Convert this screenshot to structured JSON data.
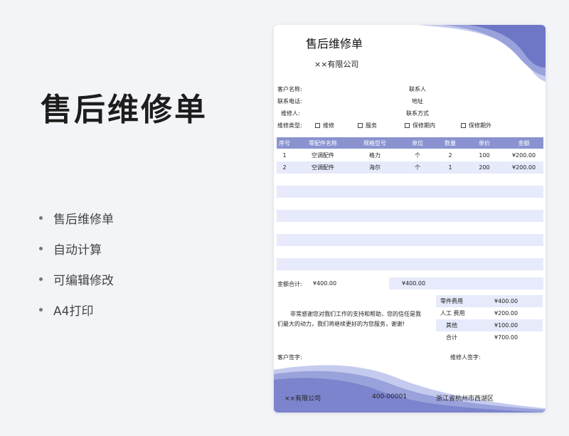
{
  "page": {
    "title": "售后维修单",
    "features": [
      "售后维修单",
      "自动计算",
      "可编辑修改",
      "A4打印"
    ]
  },
  "doc": {
    "title": "售后维修单",
    "company": "××有限公司",
    "fields": {
      "customer_name": "客户名称:",
      "contact": "联系人",
      "phone": "联系电话:",
      "address": "地址",
      "repairer": "维修人:",
      "contact_method": "联系方式",
      "repair_type": "维修类型:"
    },
    "repair_types": [
      "维修",
      "服务",
      "保修期内",
      "保修期外"
    ],
    "table": {
      "headers": [
        "序号",
        "零配件名称",
        "规格型号",
        "单位",
        "数量",
        "单价",
        "金额"
      ],
      "rows": [
        [
          "1",
          "空调配件",
          "格力",
          "个",
          "2",
          "100",
          "¥200.00"
        ],
        [
          "2",
          "空调配件",
          "海尔",
          "个",
          "1",
          "200",
          "¥200.00"
        ]
      ]
    },
    "total": {
      "label": "金额合计:",
      "value": "¥400.00",
      "value2": "¥400.00"
    },
    "costs": [
      {
        "label": "零件费用",
        "value": "¥400.00"
      },
      {
        "label": "人工 费用",
        "value": "¥200.00"
      },
      {
        "label": "其他",
        "value": "¥100.00"
      },
      {
        "label": "合计",
        "value": "¥700.00"
      }
    ],
    "thanks": "非常感谢您对我们工作的支持和帮助，您的信任是我们最大的动力，我们将继续更好的为您服务，谢谢!",
    "customer_sign": "客户签字:",
    "repairer_sign": "维修人签字:",
    "footer": {
      "company": "××有限公司",
      "phone": "400-00001",
      "address": "浙江省杭州市西湖区"
    },
    "accent": "#8a93d0",
    "stripe": "#e6eafa"
  }
}
